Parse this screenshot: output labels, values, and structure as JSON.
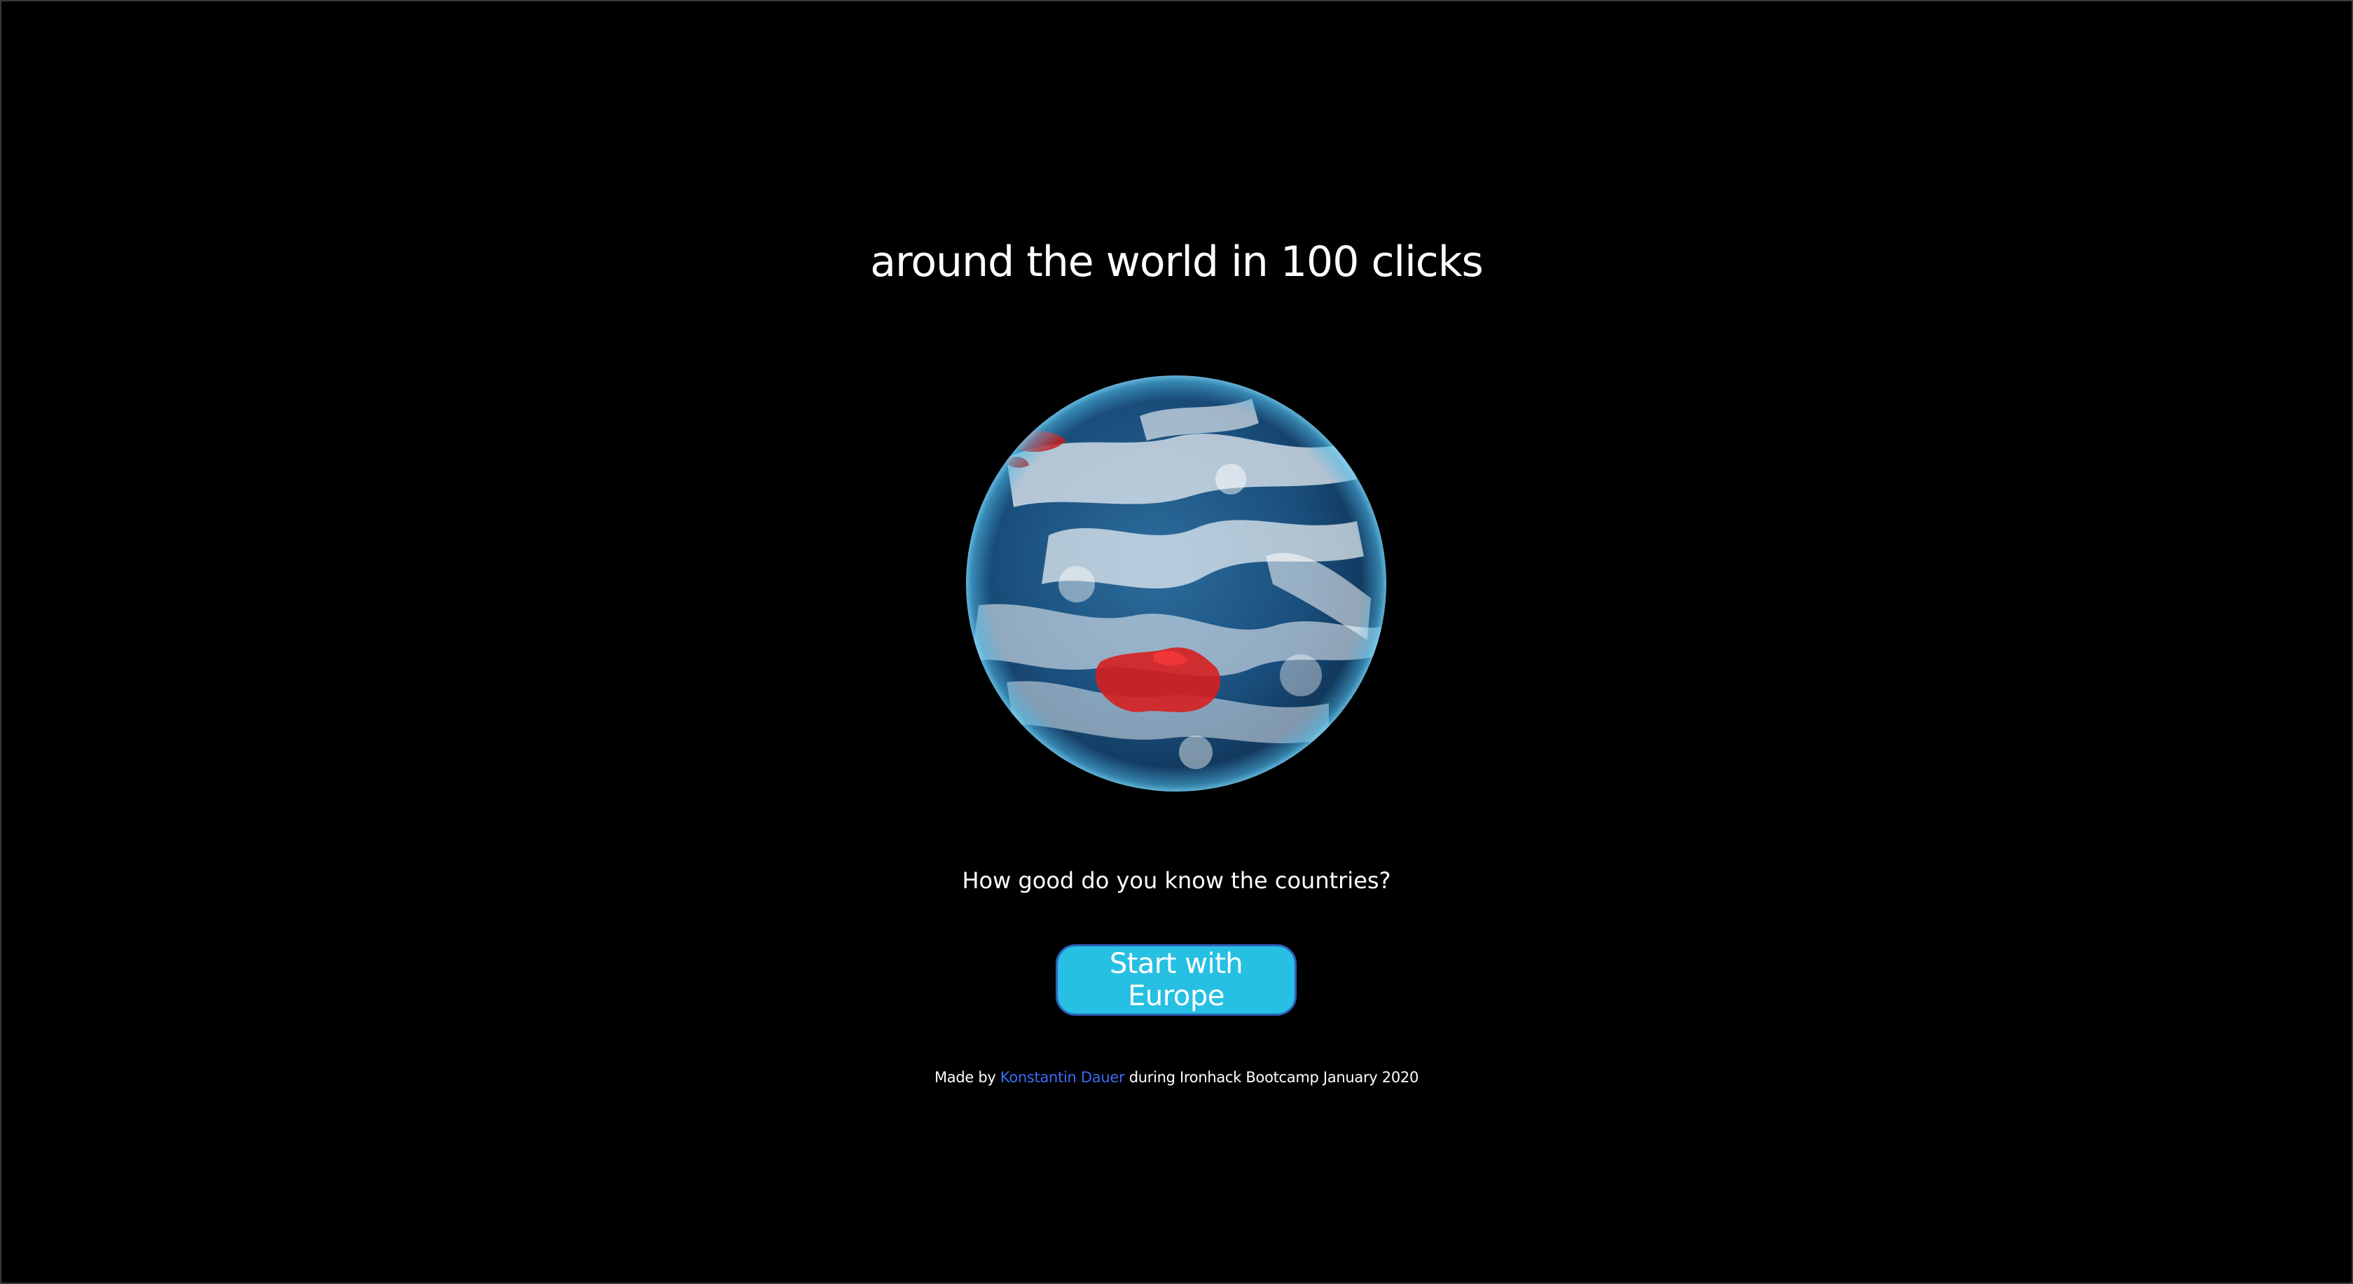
{
  "hero": {
    "title": "around the world in 100 clicks",
    "question": "How good do you know the countries?",
    "start_button_label": "Start with Europe"
  },
  "footer": {
    "prefix": "Made by",
    "author_link": "Konstantin Dauer",
    "suffix": "during Ironhack Bootcamp January 2020"
  },
  "colors": {
    "background": "#000000",
    "button_fill": "#27c0e3",
    "button_border": "#2f5fb8",
    "link": "#3b6cf2",
    "highlight_region": "#d61f1f"
  },
  "icons": {
    "globe": "earth-globe-image"
  }
}
